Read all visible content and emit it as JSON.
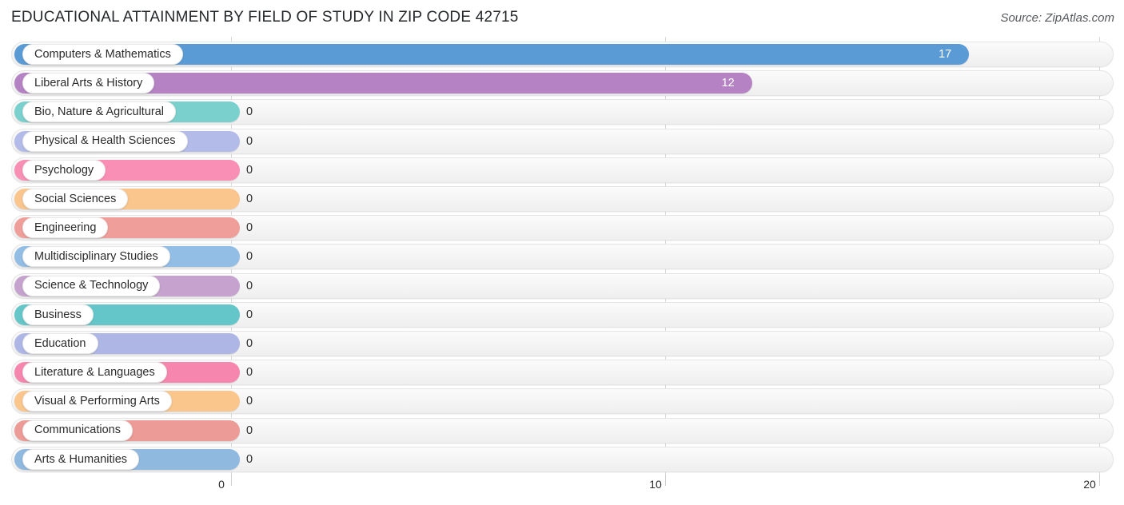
{
  "header": {
    "title": "EDUCATIONAL ATTAINMENT BY FIELD OF STUDY IN ZIP CODE 42715",
    "source": "Source: ZipAtlas.com"
  },
  "chart_data": {
    "type": "bar",
    "orientation": "horizontal",
    "title": "EDUCATIONAL ATTAINMENT BY FIELD OF STUDY IN ZIP CODE 42715",
    "xlabel": "",
    "ylabel": "",
    "xlim": [
      0,
      20
    ],
    "grid": true,
    "legend": "none",
    "xticks": [
      "0",
      "10",
      "20"
    ],
    "xtick_values": [
      0,
      10,
      20
    ],
    "categories": [
      "Computers & Mathematics",
      "Liberal Arts & History",
      "Bio, Nature & Agricultural",
      "Physical & Health Sciences",
      "Psychology",
      "Social Sciences",
      "Engineering",
      "Multidisciplinary Studies",
      "Science & Technology",
      "Business",
      "Education",
      "Literature & Languages",
      "Visual & Performing Arts",
      "Communications",
      "Arts & Humanities"
    ],
    "values": [
      17,
      12,
      0,
      0,
      0,
      0,
      0,
      0,
      0,
      0,
      0,
      0,
      0,
      0,
      0
    ],
    "value_labels": [
      "17",
      "12",
      "0",
      "0",
      "0",
      "0",
      "0",
      "0",
      "0",
      "0",
      "0",
      "0",
      "0",
      "0",
      "0"
    ],
    "colors": [
      "#5b9bd5",
      "#b583c4",
      "#7ad0cd",
      "#b3bce8",
      "#f98fb4",
      "#fac68d",
      "#ef9e9a",
      "#92bde4",
      "#c5a3ce",
      "#64c6c8",
      "#aeb6e6",
      "#f786ae",
      "#fbc68c",
      "#ec9b96",
      "#90b9e0"
    ]
  }
}
